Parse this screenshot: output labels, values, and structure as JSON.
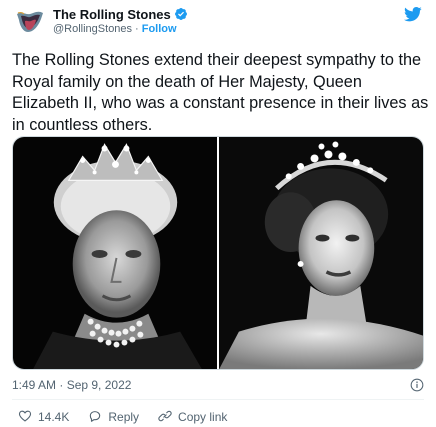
{
  "account": {
    "display_name": "The Rolling Stones",
    "handle": "@RollingStones",
    "separator": "·",
    "follow_label": "Follow"
  },
  "tweet": {
    "text": "The Rolling Stones extend their deepest sympathy to the Royal family on the death of Her Majesty, Queen Elizabeth II, who was a constant presence in their lives as in countless others.",
    "timestamp": "1:49 AM · Sep 9, 2022"
  },
  "actions": {
    "likes": "14.4K",
    "reply_label": "Reply",
    "copy_link_label": "Copy link"
  },
  "icons": {
    "avatar": "rolling-stones-tongue-logo",
    "verified": "verified-badge-icon",
    "brand": "twitter-bird-icon",
    "info": "info-icon",
    "like": "heart-icon",
    "reply": "reply-bubble-icon",
    "copy_link": "link-icon"
  },
  "colors": {
    "accent": "#1d9bf0",
    "secondary_text": "#536471",
    "primary_text": "#0f1419"
  }
}
